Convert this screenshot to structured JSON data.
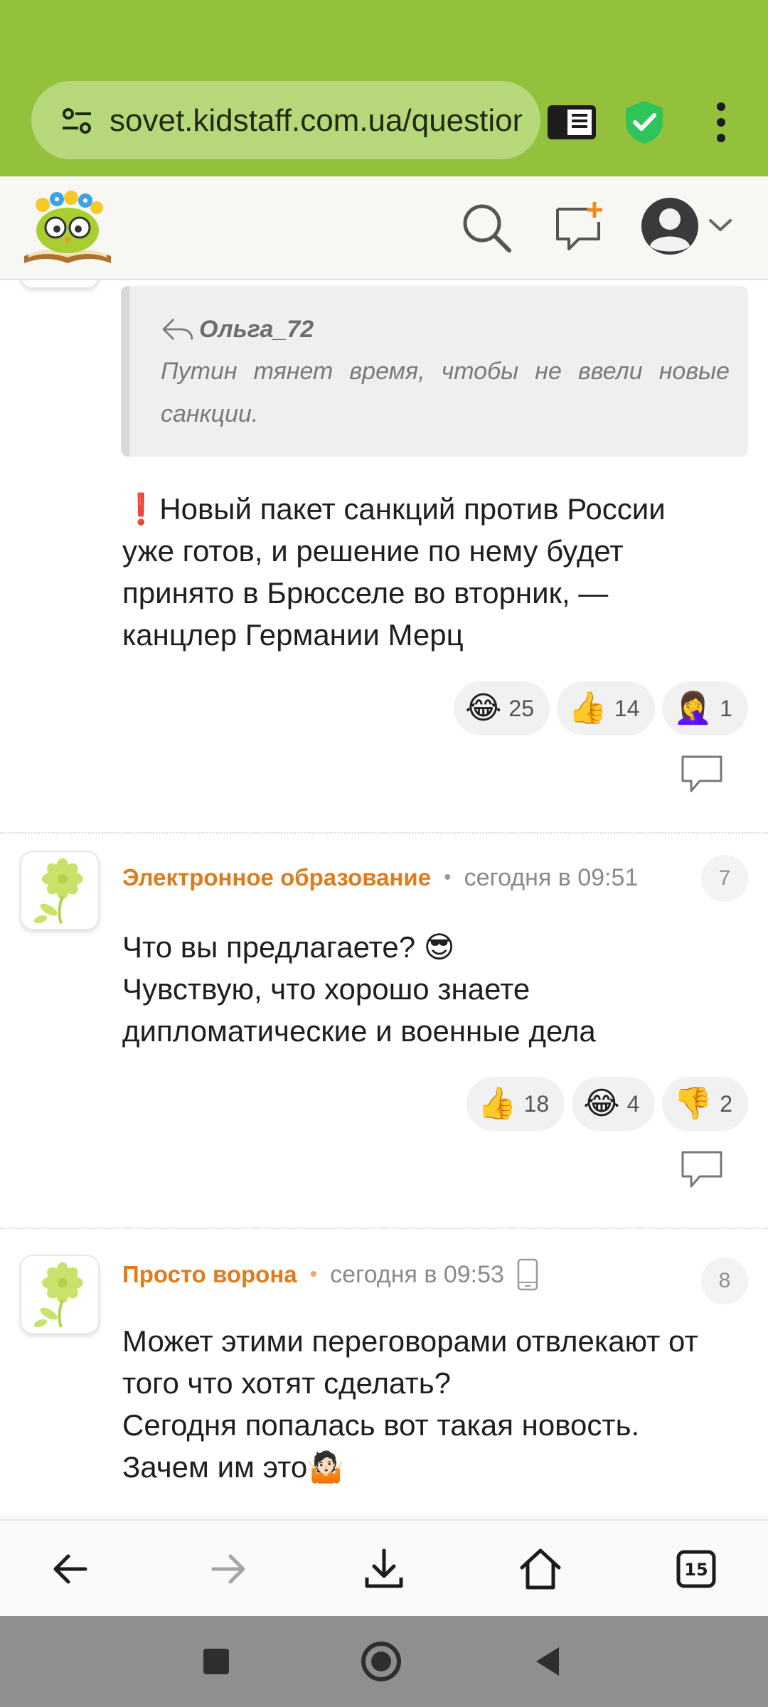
{
  "browser": {
    "url": "sovet.kidstaff.com.ua/question",
    "tabs_count": "15",
    "colors": {
      "chrome": "#93c13c",
      "urlbar": "#b6d77a",
      "shield": "#2ec45a"
    }
  },
  "header": {
    "logo_icon": "kidstaff-book-owl-logo",
    "icons": [
      "search-icon",
      "new-post-icon",
      "user-avatar-icon",
      "chevron-down-icon"
    ]
  },
  "quote": {
    "author": "Ольга_72",
    "text": "Путин тянет время, чтобы не ввели новые санкции."
  },
  "posts": [
    {
      "lines": [
        "❗Новый пакет санкций против России",
        "уже готов, и решение по нему будет",
        "принято в Брюсселе во вторник, —",
        "канцлер Германии Мерц"
      ],
      "reactions": [
        {
          "emoji": "😂",
          "count": "25"
        },
        {
          "emoji": "👍",
          "count": "14"
        },
        {
          "emoji": "🤦‍♀️",
          "count": "1"
        }
      ]
    }
  ],
  "comments": [
    {
      "number": "7",
      "author": "Электронное образование",
      "separator": "•",
      "time": "сегодня в 09:51",
      "lines": [
        "Что вы предлагаете? 😎",
        "Чувствую, что хорошо знаете",
        "дипломатические и военные дела"
      ],
      "reactions": [
        {
          "emoji": "👍",
          "count": "18"
        },
        {
          "emoji": "😂",
          "count": "4"
        },
        {
          "emoji": "👎",
          "count": "2"
        }
      ]
    },
    {
      "number": "8",
      "author": "Просто ворона",
      "separator": "•",
      "time": "сегодня в 09:53",
      "lines": [
        "Может этими переговорами отвлекают от",
        "того что хотят сделать?",
        "Сегодня попалась вот такая новость.",
        "Зачем им это🤷🏻"
      ]
    }
  ],
  "colors": {
    "author": "#e07b1b",
    "avatar_flower": "#c9e26a"
  }
}
